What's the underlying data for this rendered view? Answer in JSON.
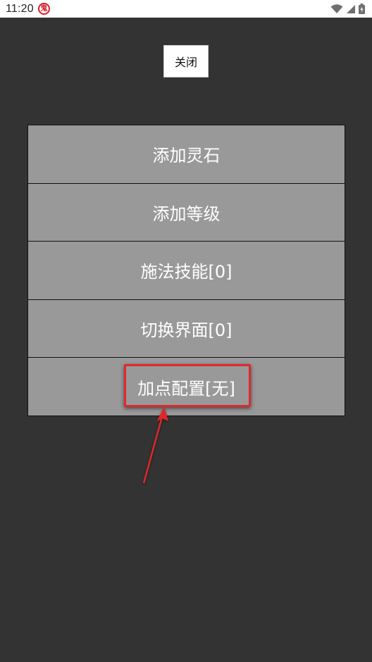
{
  "status_bar": {
    "time": "11:20",
    "notification_glyph": "鬼",
    "icons": [
      "wifi-icon",
      "signal-icon",
      "battery-icon"
    ]
  },
  "close_label": "关闭",
  "menu": {
    "items": [
      {
        "label": "添加灵石"
      },
      {
        "label": "添加等级"
      },
      {
        "label": "施法技能[0]"
      },
      {
        "label": "切换界面[0]"
      },
      {
        "label": "加点配置[无]"
      }
    ]
  },
  "annotation": {
    "highlight_target": "加点配置[无]",
    "color": "#e0282c"
  },
  "colors": {
    "background": "#333333",
    "menu_item": "#999999",
    "menu_text": "#ffffff",
    "annotation": "#e0282c"
  }
}
